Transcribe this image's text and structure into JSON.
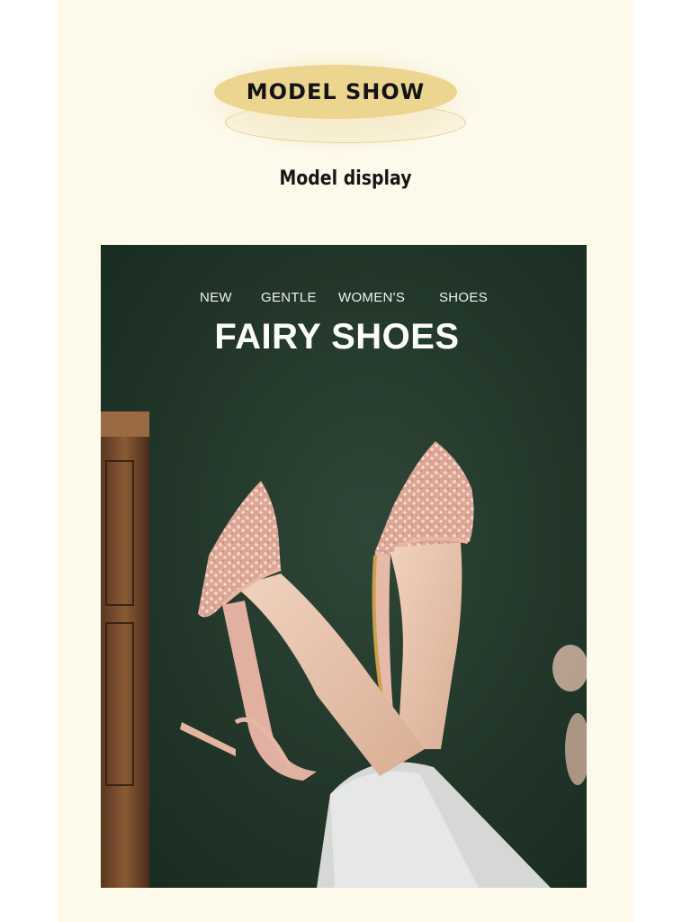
{
  "section": {
    "badge_label": "MODEL SHOW",
    "subtitle": "Model display"
  },
  "hero": {
    "taglines": [
      "NEW",
      "GENTLE",
      "WOMEN'S",
      "SHOES"
    ],
    "headline": "FAIRY SHOES",
    "image": "woman-legs-wearing-pink-sequin-pointed-slingback-heels"
  },
  "colors": {
    "page_background": "#fdfaec",
    "badge_fill": "#ecd58f",
    "photo_background": "#213628",
    "shoe_pink": "#e2b1a3",
    "text_dark": "#161616"
  }
}
